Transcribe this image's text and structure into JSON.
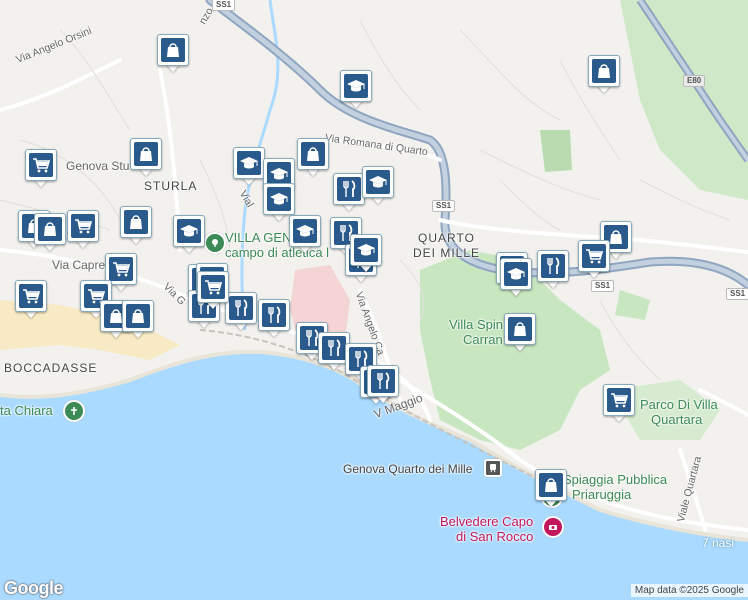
{
  "map": {
    "places": [
      {
        "text": "STURLA"
      },
      {
        "text": "QUARTO"
      },
      {
        "text": "DEI MILLE"
      },
      {
        "text": "BOCCADASSE"
      }
    ],
    "green_labels": [
      {
        "text": "VILLA GEN"
      },
      {
        "text": "campo di atletica l"
      },
      {
        "text": "Villa Spin"
      },
      {
        "text": "Carran"
      },
      {
        "text": "Parco Di Villa"
      },
      {
        "text": "Quartara"
      },
      {
        "text": "ta Chiara"
      },
      {
        "text": "Spiaggia Pubblica"
      },
      {
        "text": "Priaruggia"
      },
      {
        "text": "Belvedere Capo"
      },
      {
        "text": "di San Rocco"
      }
    ],
    "roads": [
      {
        "text": "Via Angelo Orsini"
      },
      {
        "text": "Genova Stu"
      },
      {
        "text": "Via Capre"
      },
      {
        "text": "Via Romana di Quarto"
      },
      {
        "text": "Via Angelo Ca"
      },
      {
        "text": "V Maggio"
      },
      {
        "text": "Viale Quartara"
      },
      {
        "text": "Via G"
      },
      {
        "text": "Vial"
      },
      {
        "text": "nzo"
      },
      {
        "text": "Genova Quarto dei Mille"
      }
    ],
    "sea_labels": [
      {
        "text": "7 nasi"
      }
    ],
    "shields": [
      {
        "text": "SS1"
      },
      {
        "text": "SS1"
      },
      {
        "text": "SS1"
      },
      {
        "text": "SS1"
      },
      {
        "text": "E80"
      }
    ],
    "markers": [
      {
        "icon": "shopping-bag-icon"
      },
      {
        "icon": "shopping-bag-icon"
      },
      {
        "icon": "graduation-cap-icon"
      },
      {
        "icon": "shopping-bag-icon"
      },
      {
        "icon": "shopping-cart-icon"
      },
      {
        "icon": "shopping-bag-icon"
      },
      {
        "icon": "graduation-cap-icon"
      },
      {
        "icon": "shopping-bag-icon"
      },
      {
        "icon": "graduation-cap-icon"
      },
      {
        "icon": "graduation-cap-icon"
      },
      {
        "icon": "restaurant-icon"
      },
      {
        "icon": "graduation-cap-icon"
      },
      {
        "icon": "shopping-bag-icon"
      },
      {
        "icon": "shopping-cart-icon"
      },
      {
        "icon": "shopping-bag-icon"
      },
      {
        "icon": "shopping-bag-icon"
      },
      {
        "icon": "graduation-cap-icon"
      },
      {
        "icon": "restaurant-icon"
      },
      {
        "icon": "graduation-cap-icon"
      },
      {
        "icon": "restaurant-icon"
      },
      {
        "icon": "shopping-bag-icon"
      },
      {
        "icon": "shopping-cart-icon"
      },
      {
        "icon": "shopping-cart-icon"
      },
      {
        "icon": "shopping-cart-icon"
      },
      {
        "icon": "shopping-cart-icon"
      },
      {
        "icon": "shopping-bag-icon"
      },
      {
        "icon": "graduation-cap-icon"
      },
      {
        "icon": "restaurant-icon"
      },
      {
        "icon": "restaurant-icon"
      },
      {
        "icon": "restaurant-icon"
      },
      {
        "icon": "restaurant-icon"
      },
      {
        "icon": "restaurant-icon"
      },
      {
        "icon": "restaurant-icon"
      },
      {
        "icon": "restaurant-icon"
      },
      {
        "icon": "restaurant-icon"
      },
      {
        "icon": "restaurant-icon"
      },
      {
        "icon": "graduation-cap-icon"
      },
      {
        "icon": "graduation-cap-icon"
      },
      {
        "icon": "restaurant-icon"
      },
      {
        "icon": "shopping-cart-icon"
      },
      {
        "icon": "shopping-bag-icon"
      },
      {
        "icon": "shopping-bag-icon"
      },
      {
        "icon": "shopping-cart-icon"
      },
      {
        "icon": "shopping-bag-icon"
      }
    ],
    "colors": {
      "sea": "#aadaff",
      "land": "#f2f1ee",
      "green": "#c8e6c0",
      "marker": "#2a5a8c",
      "highway": "#8fa5c0"
    }
  },
  "footer": {
    "logo": "Google",
    "attribution": "Map data ©2025 Google"
  }
}
